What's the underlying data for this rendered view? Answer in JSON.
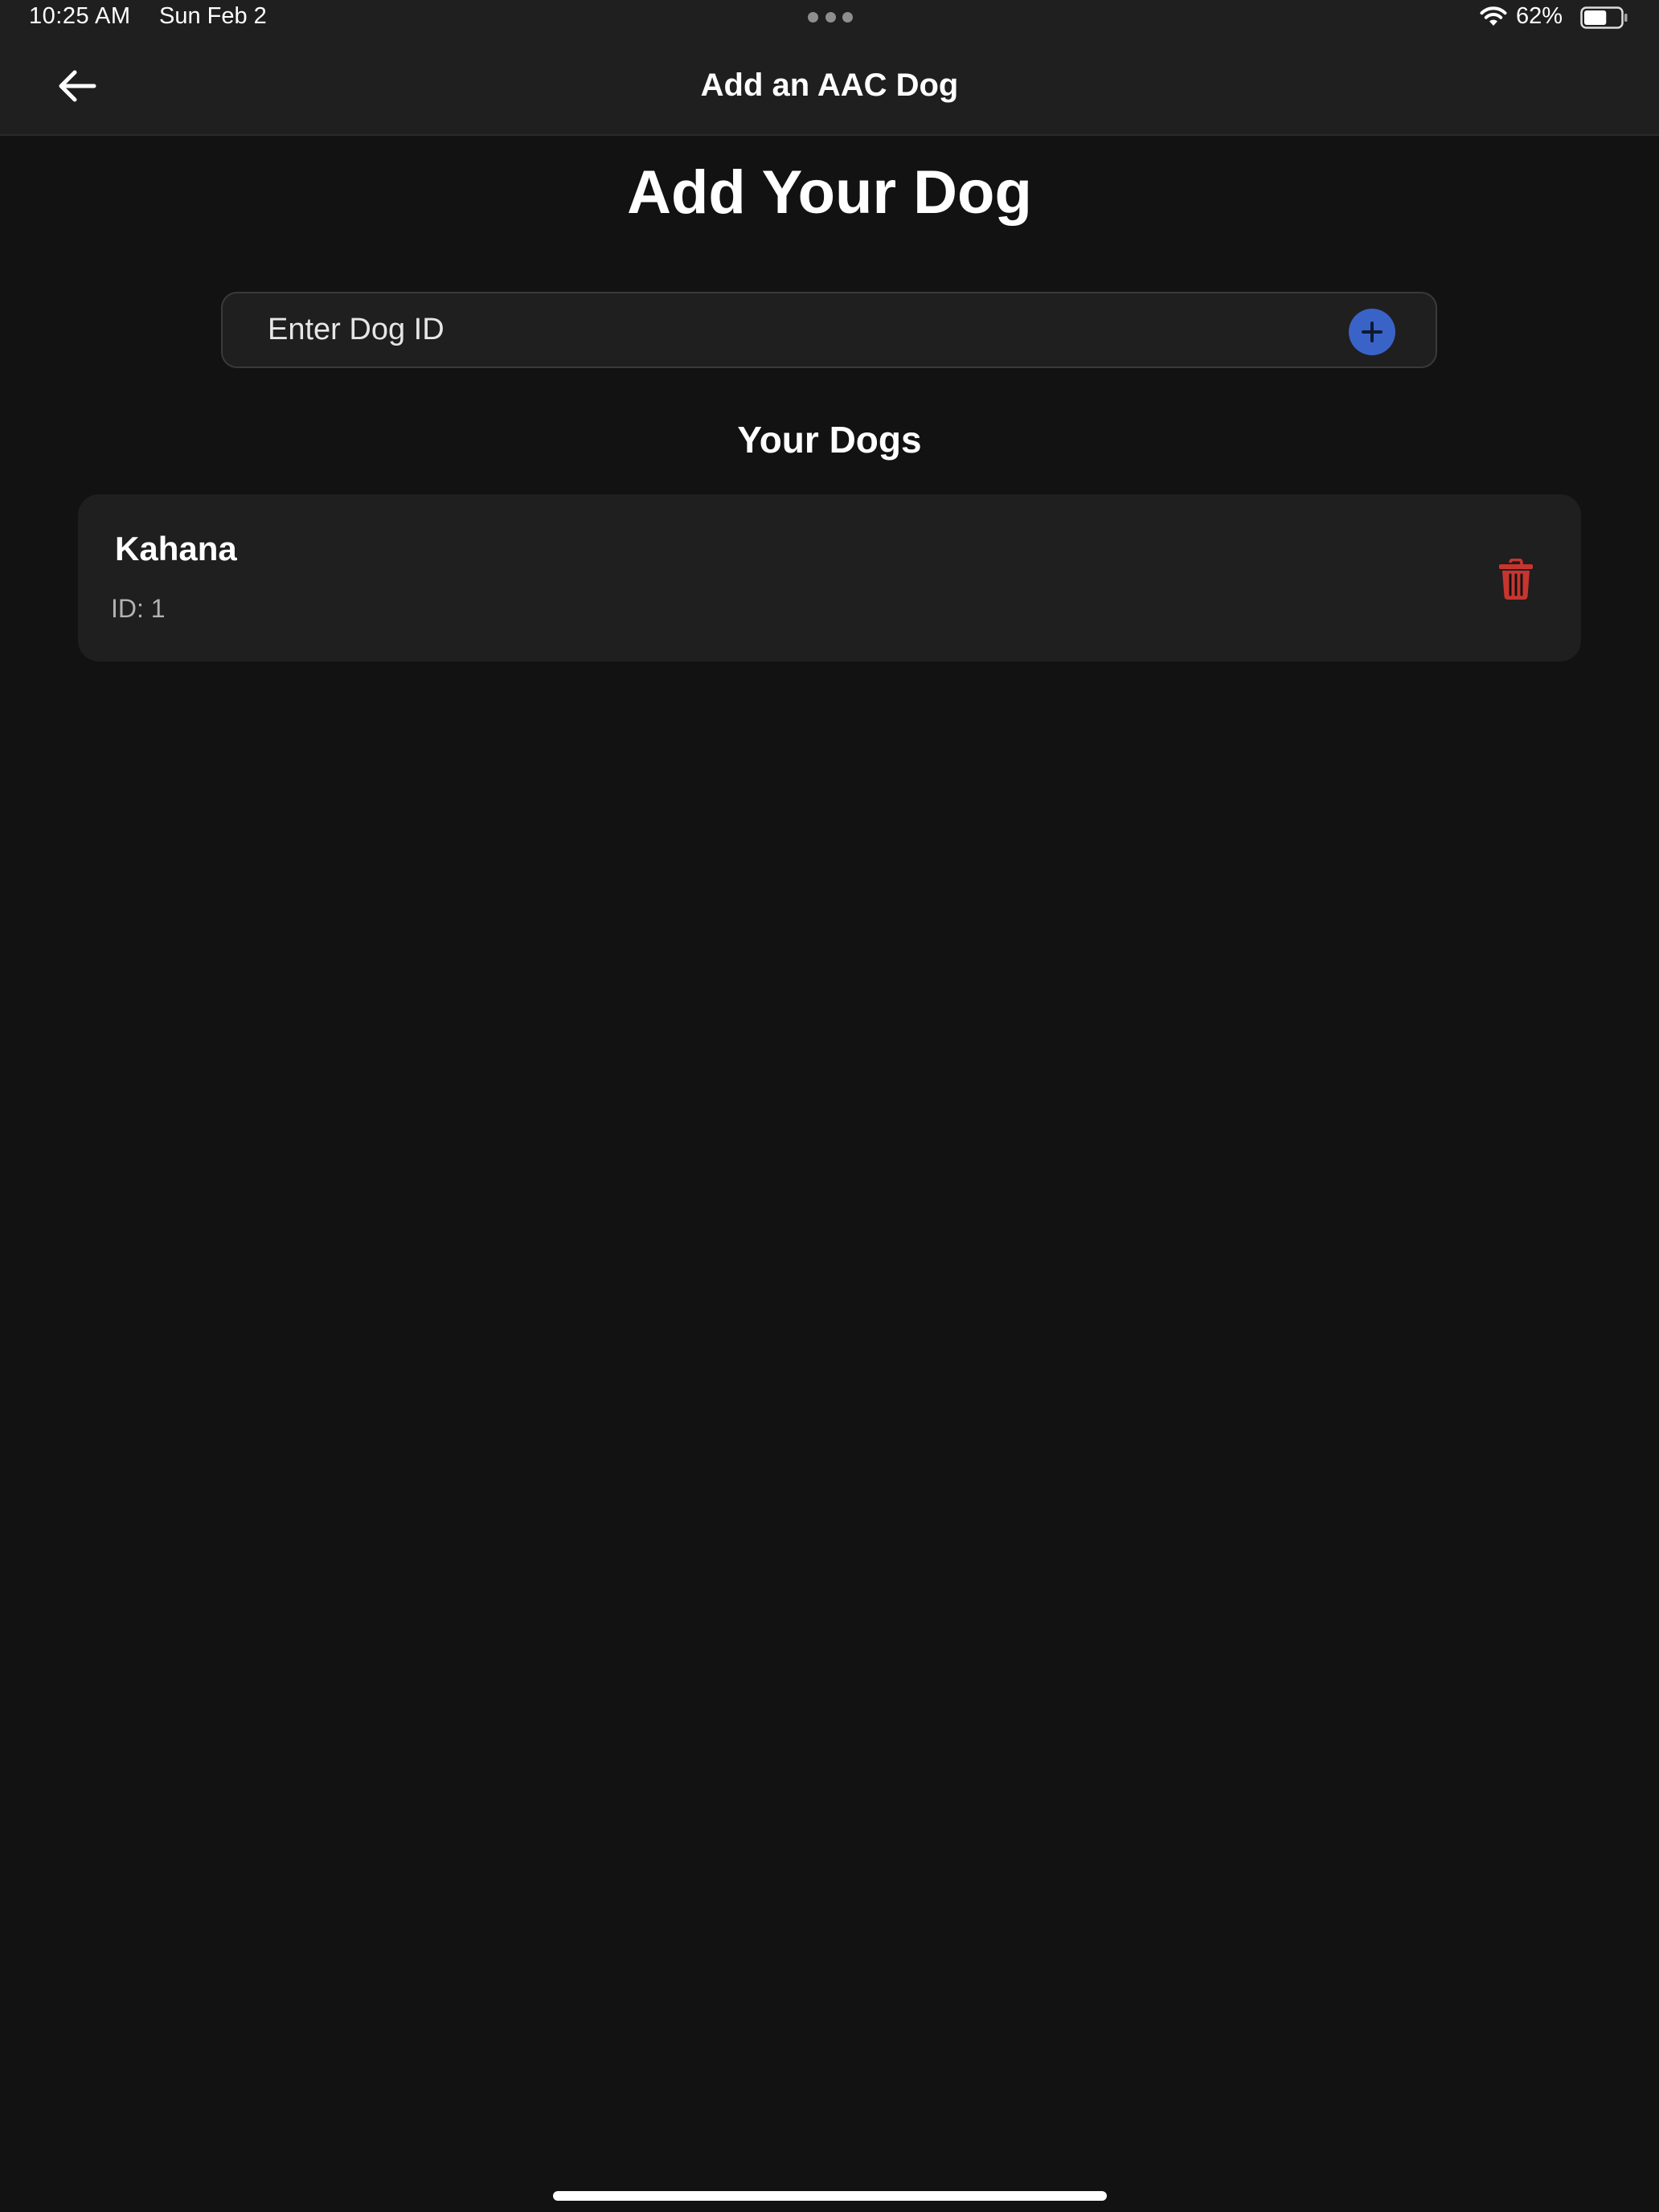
{
  "status_bar": {
    "time": "10:25 AM",
    "date": "Sun Feb 2",
    "battery_percent": "62%",
    "battery_level": 0.62
  },
  "nav": {
    "title": "Add an AAC Dog",
    "back_icon": "arrow-left-icon"
  },
  "main": {
    "title": "Add Your Dog",
    "input": {
      "placeholder": "Enter Dog ID",
      "value": ""
    },
    "add_icon": "plus-circle-icon",
    "section_title": "Your Dogs",
    "dogs": [
      {
        "name": "Kahana",
        "id_label": "ID: 1",
        "delete_icon": "trash-icon"
      }
    ]
  },
  "colors": {
    "background": "#121212",
    "bar_background": "#1f1f1f",
    "card_background": "#1f1f1f",
    "accent_blue": "#3a63c7",
    "delete_red": "#c8352f",
    "secondary_text": "#b3b3b3"
  }
}
